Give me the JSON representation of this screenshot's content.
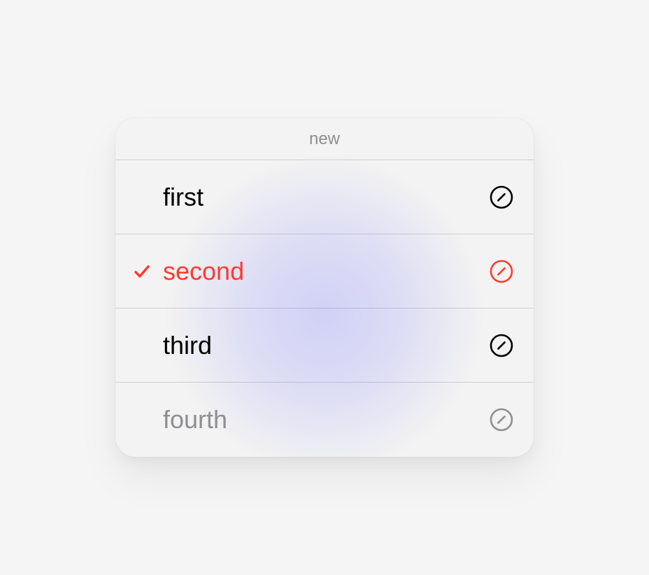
{
  "header": {
    "title": "new"
  },
  "items": [
    {
      "label": "first",
      "selected": false,
      "disabled": false
    },
    {
      "label": "second",
      "selected": true,
      "disabled": false
    },
    {
      "label": "third",
      "selected": false,
      "disabled": false
    },
    {
      "label": "fourth",
      "selected": false,
      "disabled": true
    }
  ],
  "colors": {
    "accent": "#ff3b30",
    "textPrimary": "#000000",
    "textSecondary": "#8e8e93",
    "panelBg": "#f3f3f3",
    "pageBg": "#f5f5f6"
  }
}
